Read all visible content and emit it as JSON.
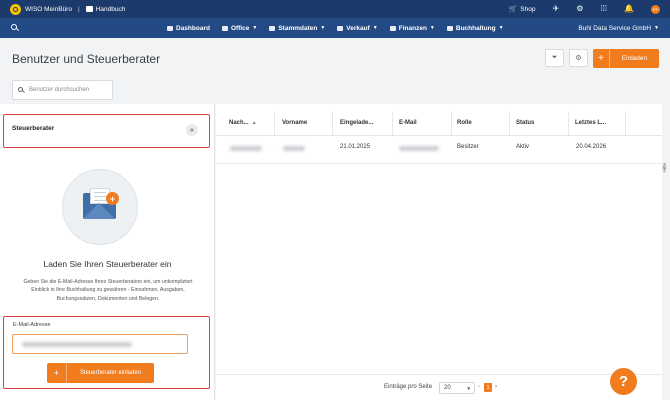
{
  "topbar": {
    "app_title": "WISO MeinBüro",
    "separator": "|",
    "handbook": "Handbuch",
    "shop": "Shop",
    "avatar_initials": "RF"
  },
  "nav": {
    "items": [
      {
        "label": "Dashboard",
        "dropdown": false
      },
      {
        "label": "Office",
        "dropdown": true
      },
      {
        "label": "Stammdaten",
        "dropdown": true
      },
      {
        "label": "Verkauf",
        "dropdown": true
      },
      {
        "label": "Finanzen",
        "dropdown": true
      },
      {
        "label": "Buchhaltung",
        "dropdown": true
      }
    ],
    "company": "Buhl Data Service GmbH"
  },
  "header": {
    "title": "Benutzer und Steuerberater",
    "invite_label": "Einladen",
    "search_placeholder": "Benutzer durchsuchen"
  },
  "left_panel": {
    "title": "Steuerberater",
    "collapse_glyph": "«",
    "headline": "Laden Sie Ihren Steuerberater ein",
    "description": "Geben Sie die E-Mail-Adresse Ihres Steuerberaters ein, um unkompliziert Einblick in Ihre Buchhaltung zu gewähren - Einnahmen, Ausgaben, Buchungssätzen, Dokumenten und Belegen.",
    "email_label": "E-Mail-Adresse",
    "submit_label": "Steuerberater einladen"
  },
  "table": {
    "columns": [
      "Nach...",
      "Vorname",
      "Eingelade...",
      "E-Mail",
      "Rolle",
      "Status",
      "Letztes L..."
    ],
    "rows": [
      {
        "nachname": "",
        "vorname": "",
        "eingeladen": "21.01.2025",
        "email": "",
        "rolle": "Besitzer",
        "status": "Aktiv",
        "letztes_login": "20.04.2026"
      }
    ]
  },
  "side_tab": "Hilfe",
  "footer": {
    "per_page_label": "Einträge pro Seite",
    "per_page_value": "20",
    "current_page": "1",
    "prev": "‹",
    "next": "›"
  },
  "help_label": "?",
  "colors": {
    "topbar": "#1c3a6b",
    "navbar": "#244a86",
    "accent": "#f07c1e",
    "highlight": "#d9403a"
  }
}
